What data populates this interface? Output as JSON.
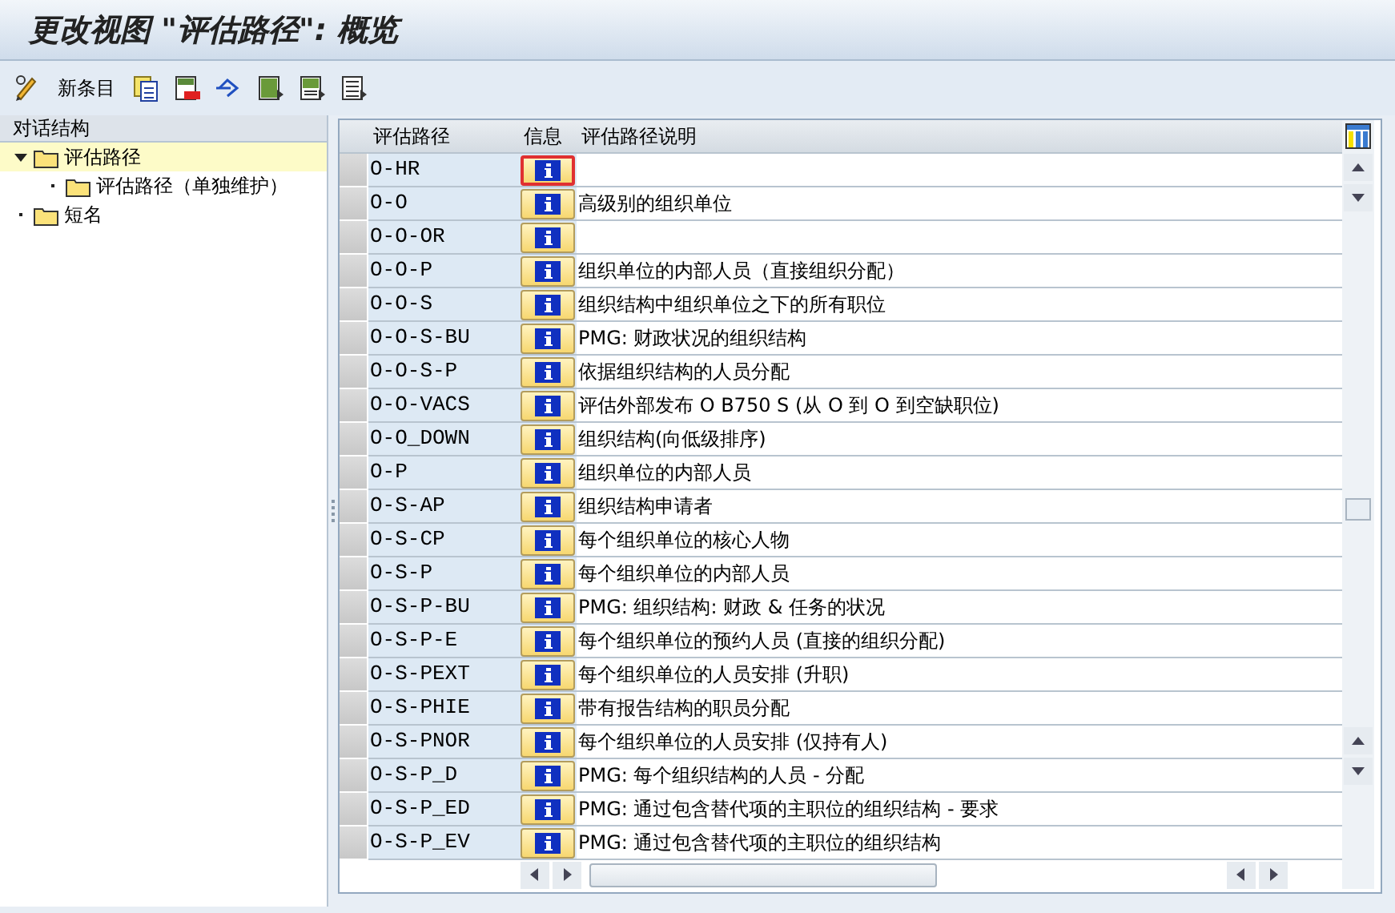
{
  "window": {
    "title": "更改视图 \"评估路径\": 概览"
  },
  "toolbar": {
    "new_entries": "新条目"
  },
  "sidebar": {
    "title": "对话结构",
    "items": [
      {
        "label": "评估路径",
        "selected": true,
        "expanded": true,
        "children": [
          {
            "label": "评估路径（单独维护）",
            "selected": false
          }
        ]
      },
      {
        "label": "短名",
        "selected": false,
        "expanded": false
      }
    ]
  },
  "table": {
    "columns": [
      "评估路径",
      "信息",
      "评估路径说明"
    ],
    "rows": [
      {
        "path": "O-HR",
        "description": "",
        "focused": true
      },
      {
        "path": "O-O",
        "description": "高级别的组织单位",
        "focused": false
      },
      {
        "path": "O-O-OR",
        "description": "",
        "focused": false
      },
      {
        "path": "O-O-P",
        "description": "组织单位的内部人员（直接组织分配）",
        "focused": false
      },
      {
        "path": "O-O-S",
        "description": "组织结构中组织单位之下的所有职位",
        "focused": false
      },
      {
        "path": "O-O-S-BU",
        "description": "PMG: 财政状况的组织结构",
        "focused": false
      },
      {
        "path": "O-O-S-P",
        "description": "依据组织结构的人员分配",
        "focused": false
      },
      {
        "path": "O-O-VACS",
        "description": "评估外部发布 O B750 S (从 O 到 O 到空缺职位)",
        "focused": false
      },
      {
        "path": "O-O_DOWN",
        "description": "组织结构(向低级排序)",
        "focused": false
      },
      {
        "path": "O-P",
        "description": "组织单位的内部人员",
        "focused": false
      },
      {
        "path": "O-S-AP",
        "description": "组织结构申请者",
        "focused": false
      },
      {
        "path": "O-S-CP",
        "description": "每个组织单位的核心人物",
        "focused": false
      },
      {
        "path": "O-S-P",
        "description": "每个组织单位的内部人员",
        "focused": false
      },
      {
        "path": "O-S-P-BU",
        "description": "PMG: 组织结构: 财政 & 任务的状况",
        "focused": false
      },
      {
        "path": "O-S-P-E",
        "description": "每个组织单位的预约人员 (直接的组织分配)",
        "focused": false
      },
      {
        "path": "O-S-PEXT",
        "description": "每个组织单位的人员安排 (升职)",
        "focused": false
      },
      {
        "path": "O-S-PHIE",
        "description": "带有报告结构的职员分配",
        "focused": false
      },
      {
        "path": "O-S-PNOR",
        "description": "每个组织单位的人员安排 (仅持有人)",
        "focused": false
      },
      {
        "path": "O-S-P_D",
        "description": "PMG: 每个组织结构的人员 - 分配",
        "focused": false
      },
      {
        "path": "O-S-P_ED",
        "description": "PMG: 通过包含替代项的主职位的组织结构 - 要求",
        "focused": false
      },
      {
        "path": "O-S-P_EV",
        "description": "PMG: 通过包含替代项的主职位的组织结构",
        "focused": false
      }
    ]
  }
}
